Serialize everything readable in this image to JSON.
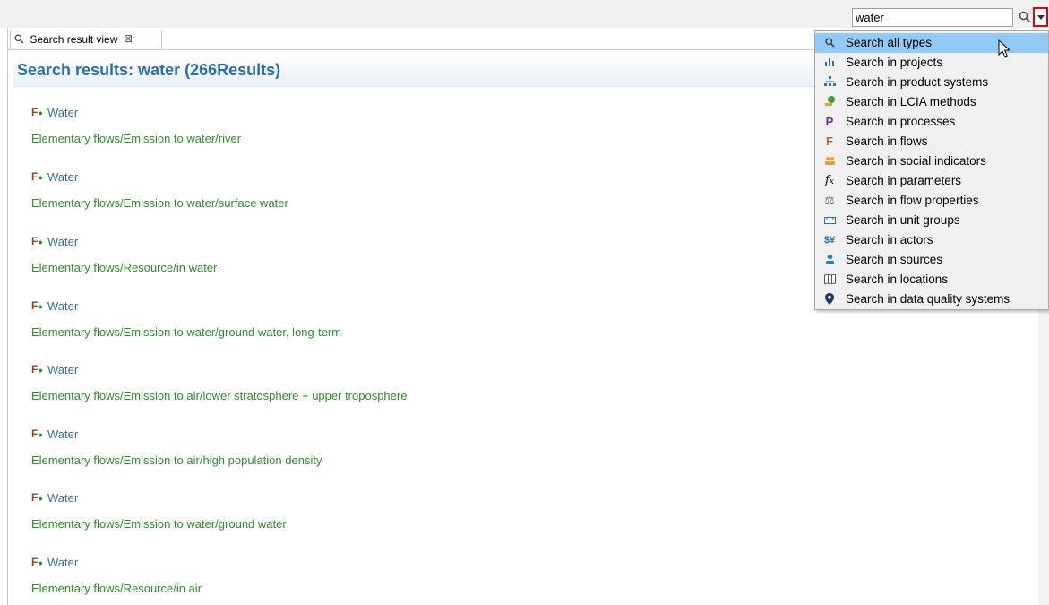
{
  "toolbar": {
    "search_value": "water"
  },
  "view": {
    "tab_label": "Search result view",
    "tab_close": "⊠",
    "title": "Search results: water (266Results)"
  },
  "results": [
    {
      "name": "Water",
      "path": "Elementary flows/Emission to water/river"
    },
    {
      "name": "Water",
      "path": "Elementary flows/Emission to water/surface water"
    },
    {
      "name": "Water",
      "path": "Elementary flows/Resource/in water"
    },
    {
      "name": "Water",
      "path": "Elementary flows/Emission to water/ground water, long-term"
    },
    {
      "name": "Water",
      "path": "Elementary flows/Emission to air/lower stratosphere + upper troposphere"
    },
    {
      "name": "Water",
      "path": "Elementary flows/Emission to air/high population density"
    },
    {
      "name": "Water",
      "path": "Elementary flows/Emission to water/ground water"
    },
    {
      "name": "Water",
      "path": "Elementary flows/Resource/in air"
    }
  ],
  "result_icon": {
    "glyph": "F",
    "icon": "flow-icon",
    "color": "#8a4a20"
  },
  "menu": {
    "items": [
      {
        "label": "Search all types",
        "icon": "search-icon",
        "glyph": "🔍",
        "color": "#333333",
        "selected": true
      },
      {
        "label": "Search in projects",
        "icon": "projects-icon",
        "glyph": "ılı",
        "color": "#2a6fb0"
      },
      {
        "label": "Search in product systems",
        "icon": "product-systems-icon",
        "glyph": "⛬",
        "color": "#2a6fb0"
      },
      {
        "label": "Search in LCIA methods",
        "icon": "lcia-methods-icon",
        "glyph": "♣",
        "color": "#3a9a3a"
      },
      {
        "label": "Search in processes",
        "icon": "processes-icon",
        "glyph": "P",
        "color": "#7a2a8a"
      },
      {
        "label": "Search in flows",
        "icon": "flows-icon",
        "glyph": "F",
        "color": "#b06a3a"
      },
      {
        "label": "Search in social indicators",
        "icon": "social-indicators-icon",
        "glyph": "👥",
        "color": "#e8a030"
      },
      {
        "label": "Search in parameters",
        "icon": "parameters-icon",
        "glyph": "𝑓ₓ",
        "color": "#333333"
      },
      {
        "label": "Search in flow properties",
        "icon": "flow-properties-icon",
        "glyph": "⚖",
        "color": "#666666"
      },
      {
        "label": "Search in unit groups",
        "icon": "unit-groups-icon",
        "glyph": "▭",
        "color": "#2a6fb0"
      },
      {
        "label": "Search in actors",
        "icon": "actors-icon",
        "glyph": "$¥",
        "color": "#2a6fb0"
      },
      {
        "label": "Search in sources",
        "icon": "sources-icon",
        "glyph": "👤",
        "color": "#2a80c0"
      },
      {
        "label": "Search in locations",
        "icon": "locations-icon",
        "glyph": "🕮",
        "color": "#555555"
      },
      {
        "label": "Search in data quality systems",
        "icon": "data-quality-systems-icon",
        "glyph": "📍",
        "color": "#1f3a5f"
      }
    ]
  }
}
